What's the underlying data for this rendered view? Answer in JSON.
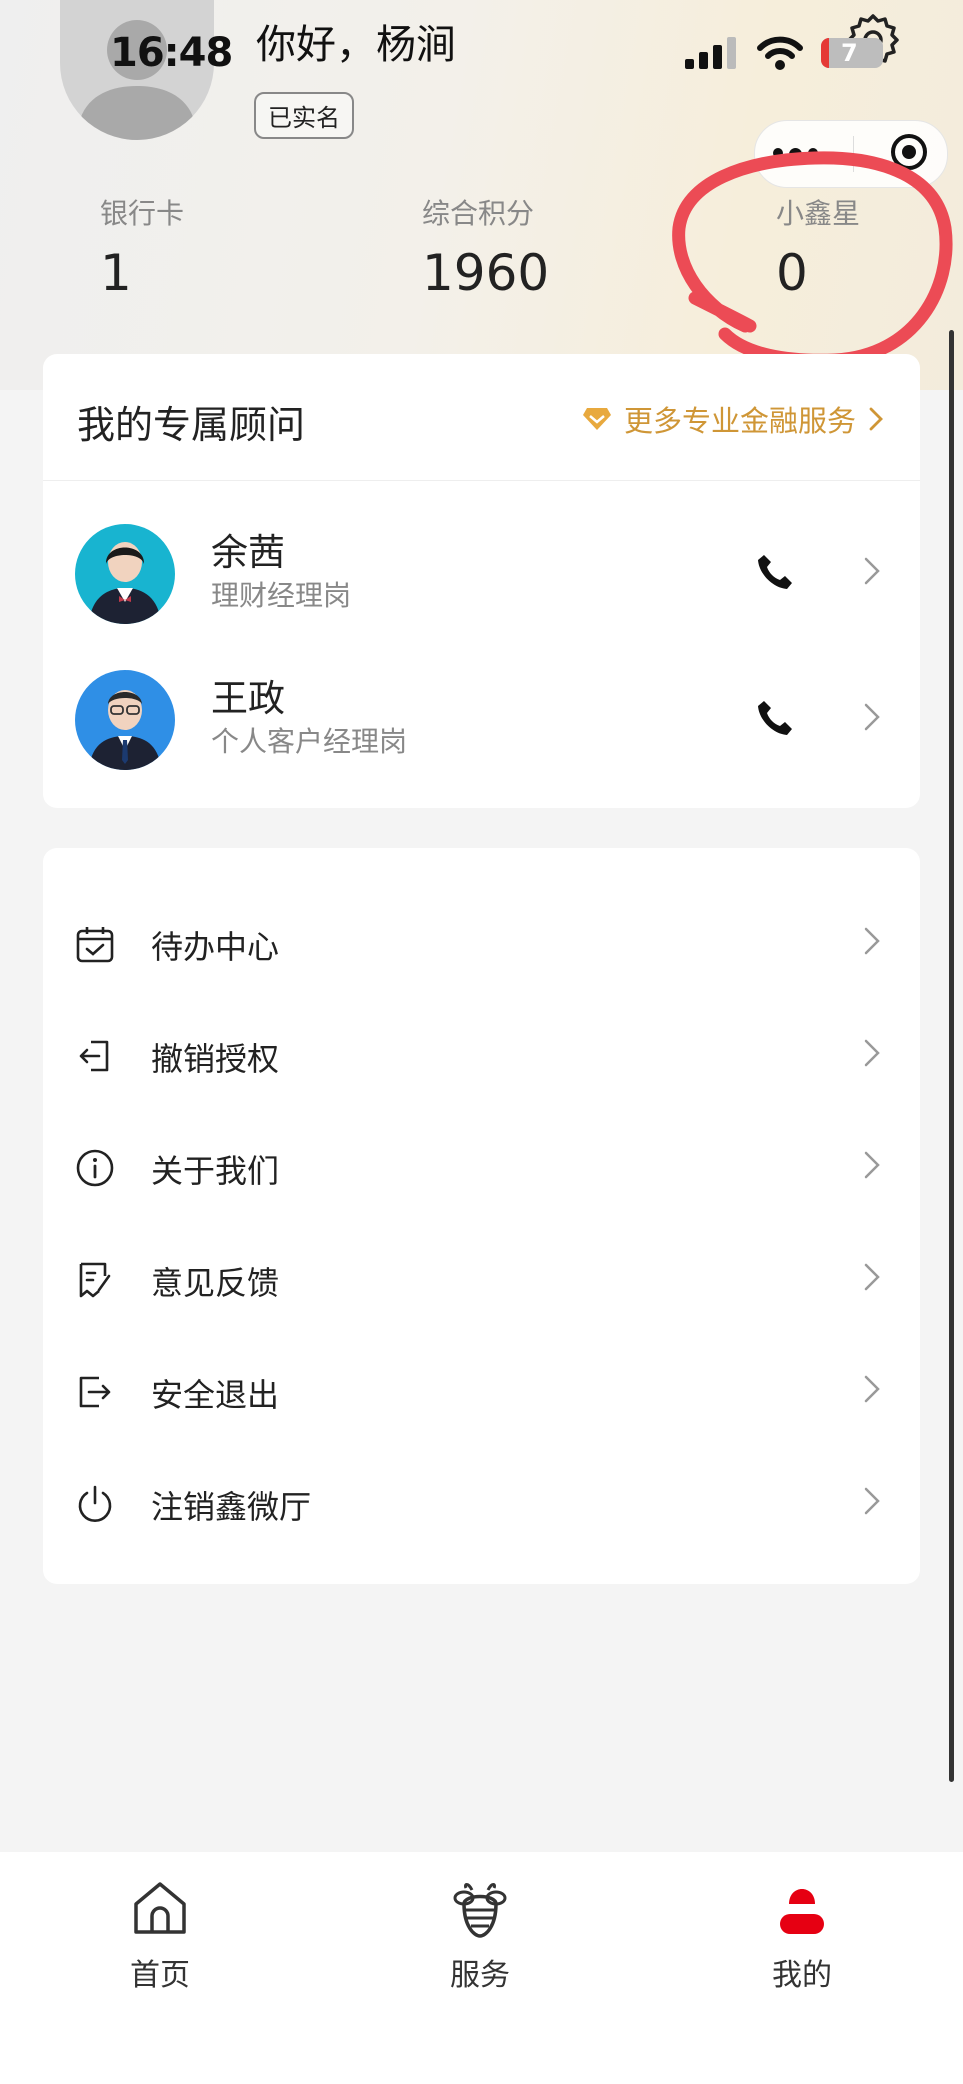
{
  "status_bar": {
    "time": "16:48",
    "battery": "7"
  },
  "profile": {
    "greeting": "你好，杨涧",
    "verified_badge": "已实名"
  },
  "stats": [
    {
      "label": "银行卡",
      "value": "1"
    },
    {
      "label": "综合积分",
      "value": "1960"
    },
    {
      "label": "小鑫星",
      "value": "0"
    }
  ],
  "advisors": {
    "title": "我的专属顾问",
    "more_link": "更多专业金融服务",
    "people": [
      {
        "name": "余茜",
        "role": "理财经理岗",
        "avatar_bg": "#18b4d0"
      },
      {
        "name": "王政",
        "role": "个人客户经理岗",
        "avatar_bg": "#2f8fe6"
      }
    ]
  },
  "menu": [
    {
      "label": "待办中心",
      "icon": "calendar-check-icon"
    },
    {
      "label": "撤销授权",
      "icon": "revoke-icon"
    },
    {
      "label": "关于我们",
      "icon": "info-icon"
    },
    {
      "label": "意见反馈",
      "icon": "feedback-icon"
    },
    {
      "label": "安全退出",
      "icon": "logout-icon"
    },
    {
      "label": "注销鑫微厅",
      "icon": "power-icon"
    }
  ],
  "tabbar": [
    {
      "label": "首页",
      "icon": "home-icon"
    },
    {
      "label": "服务",
      "icon": "bee-icon"
    },
    {
      "label": "我的",
      "icon": "profile-icon",
      "active": true
    }
  ],
  "colors": {
    "accent_gold": "#cf9636",
    "active_red": "#e60012",
    "annotation_red": "#ec4b55"
  }
}
